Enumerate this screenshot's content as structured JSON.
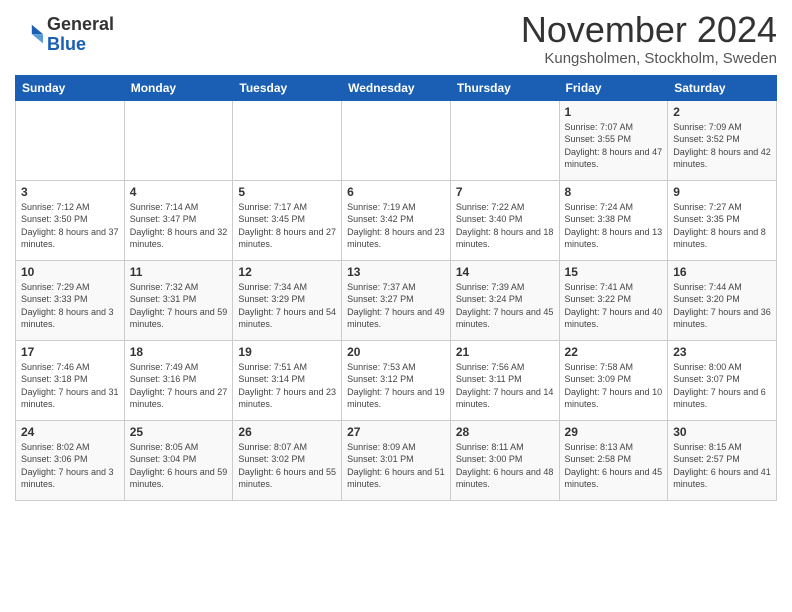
{
  "logo": {
    "general": "General",
    "blue": "Blue"
  },
  "title": {
    "month": "November 2024",
    "location": "Kungsholmen, Stockholm, Sweden"
  },
  "headers": [
    "Sunday",
    "Monday",
    "Tuesday",
    "Wednesday",
    "Thursday",
    "Friday",
    "Saturday"
  ],
  "weeks": [
    [
      {
        "day": "",
        "info": ""
      },
      {
        "day": "",
        "info": ""
      },
      {
        "day": "",
        "info": ""
      },
      {
        "day": "",
        "info": ""
      },
      {
        "day": "",
        "info": ""
      },
      {
        "day": "1",
        "info": "Sunrise: 7:07 AM\nSunset: 3:55 PM\nDaylight: 8 hours and 47 minutes."
      },
      {
        "day": "2",
        "info": "Sunrise: 7:09 AM\nSunset: 3:52 PM\nDaylight: 8 hours and 42 minutes."
      }
    ],
    [
      {
        "day": "3",
        "info": "Sunrise: 7:12 AM\nSunset: 3:50 PM\nDaylight: 8 hours and 37 minutes."
      },
      {
        "day": "4",
        "info": "Sunrise: 7:14 AM\nSunset: 3:47 PM\nDaylight: 8 hours and 32 minutes."
      },
      {
        "day": "5",
        "info": "Sunrise: 7:17 AM\nSunset: 3:45 PM\nDaylight: 8 hours and 27 minutes."
      },
      {
        "day": "6",
        "info": "Sunrise: 7:19 AM\nSunset: 3:42 PM\nDaylight: 8 hours and 23 minutes."
      },
      {
        "day": "7",
        "info": "Sunrise: 7:22 AM\nSunset: 3:40 PM\nDaylight: 8 hours and 18 minutes."
      },
      {
        "day": "8",
        "info": "Sunrise: 7:24 AM\nSunset: 3:38 PM\nDaylight: 8 hours and 13 minutes."
      },
      {
        "day": "9",
        "info": "Sunrise: 7:27 AM\nSunset: 3:35 PM\nDaylight: 8 hours and 8 minutes."
      }
    ],
    [
      {
        "day": "10",
        "info": "Sunrise: 7:29 AM\nSunset: 3:33 PM\nDaylight: 8 hours and 3 minutes."
      },
      {
        "day": "11",
        "info": "Sunrise: 7:32 AM\nSunset: 3:31 PM\nDaylight: 7 hours and 59 minutes."
      },
      {
        "day": "12",
        "info": "Sunrise: 7:34 AM\nSunset: 3:29 PM\nDaylight: 7 hours and 54 minutes."
      },
      {
        "day": "13",
        "info": "Sunrise: 7:37 AM\nSunset: 3:27 PM\nDaylight: 7 hours and 49 minutes."
      },
      {
        "day": "14",
        "info": "Sunrise: 7:39 AM\nSunset: 3:24 PM\nDaylight: 7 hours and 45 minutes."
      },
      {
        "day": "15",
        "info": "Sunrise: 7:41 AM\nSunset: 3:22 PM\nDaylight: 7 hours and 40 minutes."
      },
      {
        "day": "16",
        "info": "Sunrise: 7:44 AM\nSunset: 3:20 PM\nDaylight: 7 hours and 36 minutes."
      }
    ],
    [
      {
        "day": "17",
        "info": "Sunrise: 7:46 AM\nSunset: 3:18 PM\nDaylight: 7 hours and 31 minutes."
      },
      {
        "day": "18",
        "info": "Sunrise: 7:49 AM\nSunset: 3:16 PM\nDaylight: 7 hours and 27 minutes."
      },
      {
        "day": "19",
        "info": "Sunrise: 7:51 AM\nSunset: 3:14 PM\nDaylight: 7 hours and 23 minutes."
      },
      {
        "day": "20",
        "info": "Sunrise: 7:53 AM\nSunset: 3:12 PM\nDaylight: 7 hours and 19 minutes."
      },
      {
        "day": "21",
        "info": "Sunrise: 7:56 AM\nSunset: 3:11 PM\nDaylight: 7 hours and 14 minutes."
      },
      {
        "day": "22",
        "info": "Sunrise: 7:58 AM\nSunset: 3:09 PM\nDaylight: 7 hours and 10 minutes."
      },
      {
        "day": "23",
        "info": "Sunrise: 8:00 AM\nSunset: 3:07 PM\nDaylight: 7 hours and 6 minutes."
      }
    ],
    [
      {
        "day": "24",
        "info": "Sunrise: 8:02 AM\nSunset: 3:06 PM\nDaylight: 7 hours and 3 minutes."
      },
      {
        "day": "25",
        "info": "Sunrise: 8:05 AM\nSunset: 3:04 PM\nDaylight: 6 hours and 59 minutes."
      },
      {
        "day": "26",
        "info": "Sunrise: 8:07 AM\nSunset: 3:02 PM\nDaylight: 6 hours and 55 minutes."
      },
      {
        "day": "27",
        "info": "Sunrise: 8:09 AM\nSunset: 3:01 PM\nDaylight: 6 hours and 51 minutes."
      },
      {
        "day": "28",
        "info": "Sunrise: 8:11 AM\nSunset: 3:00 PM\nDaylight: 6 hours and 48 minutes."
      },
      {
        "day": "29",
        "info": "Sunrise: 8:13 AM\nSunset: 2:58 PM\nDaylight: 6 hours and 45 minutes."
      },
      {
        "day": "30",
        "info": "Sunrise: 8:15 AM\nSunset: 2:57 PM\nDaylight: 6 hours and 41 minutes."
      }
    ]
  ]
}
